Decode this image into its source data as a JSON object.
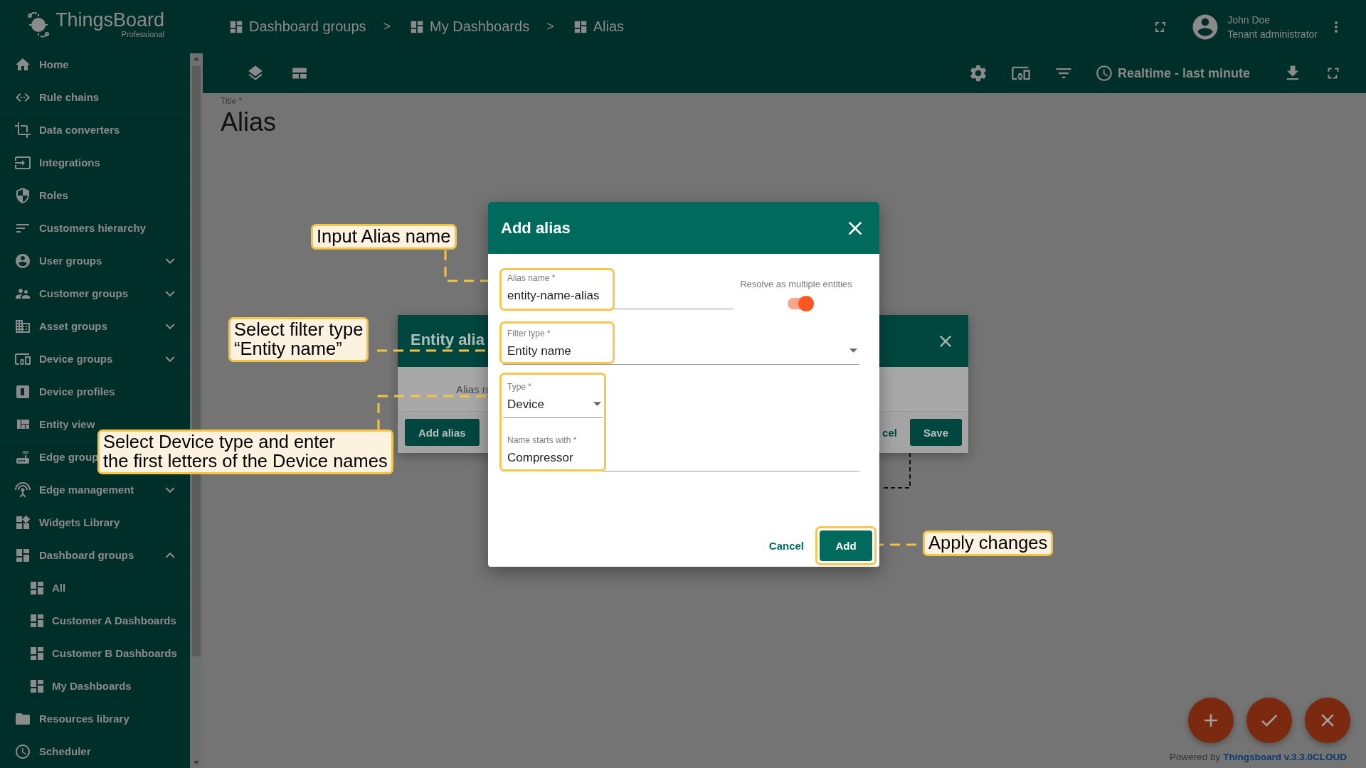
{
  "sidebar": {
    "logo": {
      "name": "ThingsBoard",
      "edition": "Professional"
    },
    "items": [
      {
        "label": "Home",
        "kind": "link"
      },
      {
        "label": "Rule chains",
        "kind": "link"
      },
      {
        "label": "Data converters",
        "kind": "link"
      },
      {
        "label": "Integrations",
        "kind": "link"
      },
      {
        "label": "Roles",
        "kind": "link"
      },
      {
        "label": "Customers hierarchy",
        "kind": "link"
      },
      {
        "label": "User groups",
        "kind": "group",
        "expanded": false
      },
      {
        "label": "Customer groups",
        "kind": "group",
        "expanded": false
      },
      {
        "label": "Asset groups",
        "kind": "group",
        "expanded": false
      },
      {
        "label": "Device groups",
        "kind": "group",
        "expanded": false
      },
      {
        "label": "Device profiles",
        "kind": "link"
      },
      {
        "label": "Entity view",
        "kind": "link"
      },
      {
        "label": "Edge group",
        "kind": "link"
      },
      {
        "label": "Edge management",
        "kind": "group",
        "expanded": false
      },
      {
        "label": "Widgets Library",
        "kind": "link"
      },
      {
        "label": "Dashboard groups",
        "kind": "group",
        "expanded": true,
        "children": [
          {
            "label": "All"
          },
          {
            "label": "Customer A Dashboards"
          },
          {
            "label": "Customer B Dashboards"
          },
          {
            "label": "My Dashboards"
          }
        ]
      },
      {
        "label": "Resources library",
        "kind": "link"
      },
      {
        "label": "Scheduler",
        "kind": "link"
      }
    ]
  },
  "breadcrumbs": [
    {
      "label": "Dashboard groups",
      "separator": ">"
    },
    {
      "label": "My Dashboards",
      "separator": ">"
    },
    {
      "label": "Alias"
    }
  ],
  "user": {
    "name": "John Doe",
    "role": "Tenant administrator"
  },
  "toolbar": {
    "timewindow": "Realtime - last minute"
  },
  "page": {
    "title_label": "Title *",
    "title": "Alias"
  },
  "background_dialog": {
    "title": "Entity alia",
    "column_label": "Alias n",
    "buttons": [
      {
        "label": "Add alias",
        "kind": "raised"
      },
      {
        "label": "cel",
        "kind": "flat"
      },
      {
        "label": "Save",
        "kind": "raised"
      }
    ]
  },
  "dialog": {
    "title": "Add alias",
    "fields": [
      {
        "label": "Alias name *",
        "value": "entity-name-alias",
        "kind": "input"
      },
      {
        "label": "Filter type *",
        "value": "Entity name",
        "kind": "select"
      },
      {
        "label": "Type *",
        "value": "Device",
        "kind": "select"
      },
      {
        "label": "Name starts with *",
        "value": "Compressor",
        "kind": "input"
      }
    ],
    "toggle": {
      "label": "Resolve as multiple entities",
      "on": true
    },
    "buttons": [
      {
        "label": "Cancel",
        "kind": "flat"
      },
      {
        "label": "Add",
        "kind": "raised"
      }
    ]
  },
  "callouts": [
    {
      "text": "Input Alias name"
    },
    {
      "text": "Select filter type\n“Entity name”"
    },
    {
      "text": "Select Device type and enter\nthe first letters of the Device names"
    },
    {
      "text": "Apply changes"
    }
  ],
  "footer": {
    "text": "Powered by",
    "link": "Thingsboard v.3.3.0CLOUD"
  }
}
